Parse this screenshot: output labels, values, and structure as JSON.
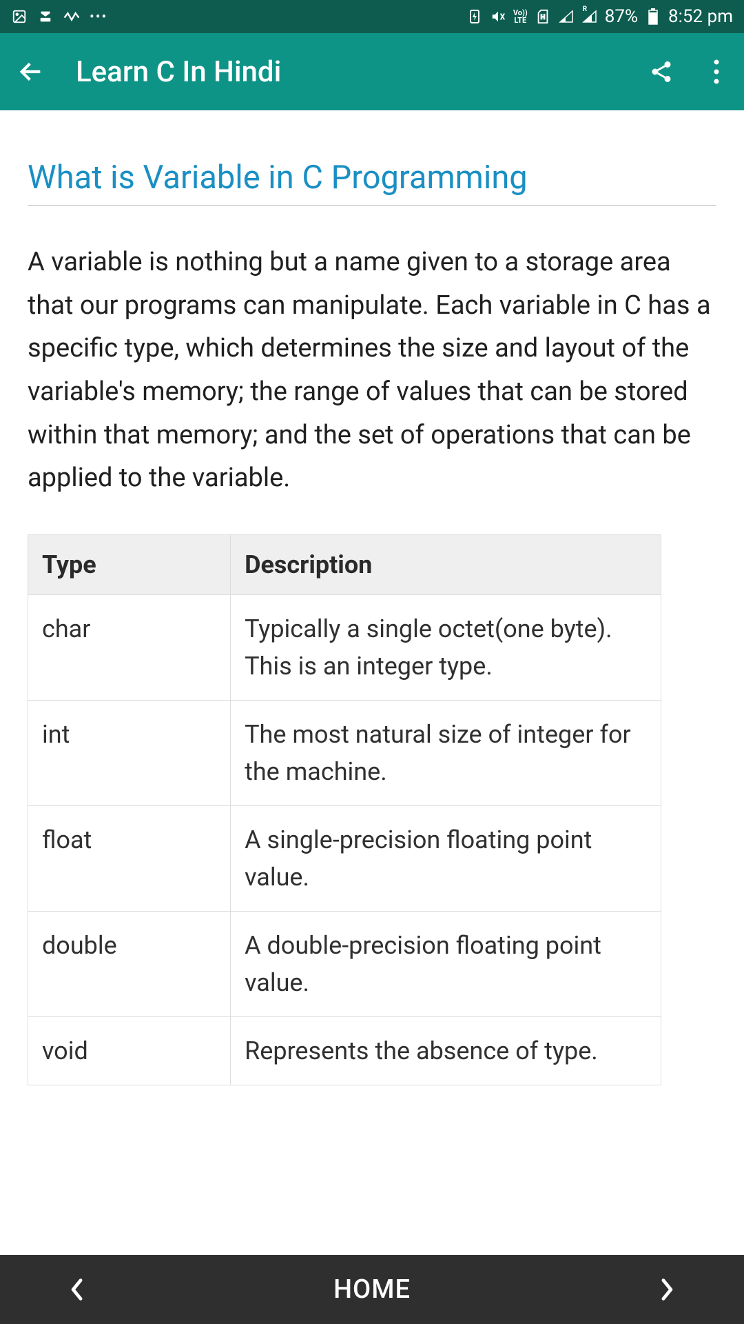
{
  "status_bar": {
    "battery_percent": "87%",
    "time": "8:52 pm",
    "volte_top": "Vo))",
    "volte_bottom": "LTE",
    "network_label": "R"
  },
  "app_bar": {
    "title": "Learn C In Hindi"
  },
  "content": {
    "heading": "What is Variable in C Programming",
    "paragraph": "A variable is nothing but a name given to a storage area that our programs can manipulate. Each variable in C has a specific type, which determines the size and layout of the variable's memory; the range of values that can be stored within that memory; and the set of operations that can be applied to the variable."
  },
  "table": {
    "headers": {
      "col1": "Type",
      "col2": "Description"
    },
    "rows": [
      {
        "type": "char",
        "desc": "Typically a single octet(one byte). This is an integer type."
      },
      {
        "type": "int",
        "desc": "The most natural size of integer for the machine."
      },
      {
        "type": "float",
        "desc": "A single-precision floating point value."
      },
      {
        "type": "double",
        "desc": "A double-precision floating point value."
      },
      {
        "type": "void",
        "desc": "Represents the absence of type."
      }
    ]
  },
  "bottom_nav": {
    "home_label": "HOME"
  }
}
